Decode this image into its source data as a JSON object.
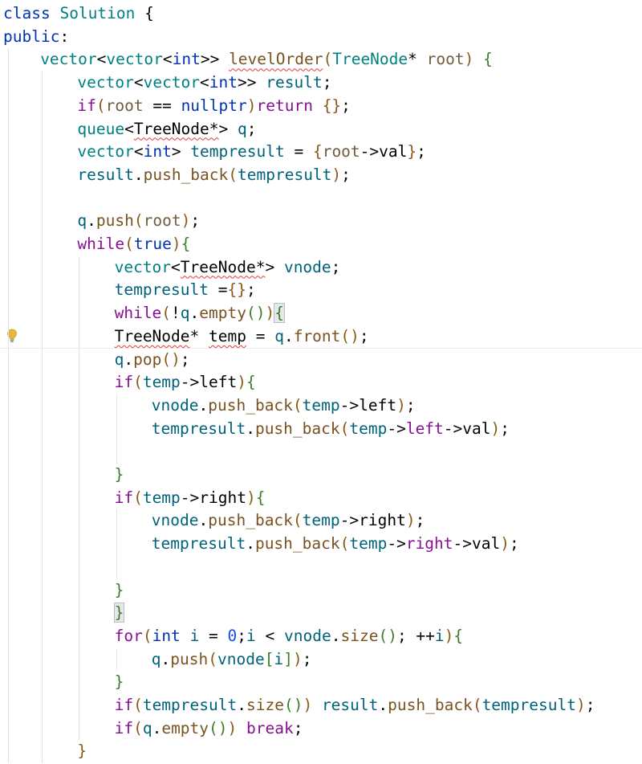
{
  "editor": {
    "lines": [
      {
        "indent": 0,
        "tokens": [
          {
            "t": "class ",
            "c": "t-kw"
          },
          {
            "t": "Solution",
            "c": "t-type"
          },
          {
            "t": " {",
            "c": "t-op"
          }
        ]
      },
      {
        "indent": 0,
        "tokens": [
          {
            "t": "public",
            "c": "t-kw"
          },
          {
            "t": ":",
            "c": "t-op"
          }
        ]
      },
      {
        "indent": 1,
        "tokens": [
          {
            "t": "vector",
            "c": "t-type"
          },
          {
            "t": "<",
            "c": "t-op"
          },
          {
            "t": "vector",
            "c": "t-type"
          },
          {
            "t": "<",
            "c": "t-op"
          },
          {
            "t": "int",
            "c": "t-kw"
          },
          {
            "t": ">> ",
            "c": "t-op"
          },
          {
            "t": "levelOrder",
            "c": "t-method",
            "sq": true
          },
          {
            "t": "(",
            "c": "t-paren1"
          },
          {
            "t": "TreeNode",
            "c": "t-type"
          },
          {
            "t": "* ",
            "c": "t-op"
          },
          {
            "t": "root",
            "c": "t-param"
          },
          {
            "t": ") ",
            "c": "t-paren1"
          },
          {
            "t": "{",
            "c": "t-paren2"
          }
        ]
      },
      {
        "indent": 2,
        "tokens": [
          {
            "t": "vector",
            "c": "t-type"
          },
          {
            "t": "<",
            "c": "t-op"
          },
          {
            "t": "vector",
            "c": "t-type"
          },
          {
            "t": "<",
            "c": "t-op"
          },
          {
            "t": "int",
            "c": "t-kw"
          },
          {
            "t": ">> ",
            "c": "t-op"
          },
          {
            "t": "result",
            "c": "t-fn"
          },
          {
            "t": ";",
            "c": "t-op"
          }
        ]
      },
      {
        "indent": 2,
        "tokens": [
          {
            "t": "if",
            "c": "t-ctl"
          },
          {
            "t": "(",
            "c": "t-paren1"
          },
          {
            "t": "root",
            "c": "t-param"
          },
          {
            "t": " == ",
            "c": "t-op"
          },
          {
            "t": "nullptr",
            "c": "t-kw"
          },
          {
            "t": ")",
            "c": "t-paren1"
          },
          {
            "t": "return ",
            "c": "t-ctl"
          },
          {
            "t": "{}",
            "c": "t-paren1"
          },
          {
            "t": ";",
            "c": "t-op"
          }
        ]
      },
      {
        "indent": 2,
        "tokens": [
          {
            "t": "queue",
            "c": "t-type"
          },
          {
            "t": "<",
            "c": "t-op"
          },
          {
            "t": "TreeNode*",
            "c": "t-cls",
            "sq": true
          },
          {
            "t": "> ",
            "c": "t-op"
          },
          {
            "t": "q",
            "c": "t-fn"
          },
          {
            "t": ";",
            "c": "t-op"
          }
        ]
      },
      {
        "indent": 2,
        "tokens": [
          {
            "t": "vector",
            "c": "t-type"
          },
          {
            "t": "<",
            "c": "t-op"
          },
          {
            "t": "int",
            "c": "t-kw"
          },
          {
            "t": "> ",
            "c": "t-op"
          },
          {
            "t": "tempresult",
            "c": "t-fn"
          },
          {
            "t": " = ",
            "c": "t-op"
          },
          {
            "t": "{",
            "c": "t-paren1"
          },
          {
            "t": "root",
            "c": "t-param"
          },
          {
            "t": "->",
            "c": "t-op"
          },
          {
            "t": "val",
            "c": "t-cls"
          },
          {
            "t": "}",
            "c": "t-paren1"
          },
          {
            "t": ";",
            "c": "t-op"
          }
        ]
      },
      {
        "indent": 2,
        "tokens": [
          {
            "t": "result",
            "c": "t-fn"
          },
          {
            "t": ".",
            "c": "t-op"
          },
          {
            "t": "push_back",
            "c": "t-method"
          },
          {
            "t": "(",
            "c": "t-paren1"
          },
          {
            "t": "tempresult",
            "c": "t-fn"
          },
          {
            "t": ")",
            "c": "t-paren1"
          },
          {
            "t": ";",
            "c": "t-op"
          }
        ]
      },
      {
        "indent": 2,
        "tokens": []
      },
      {
        "indent": 2,
        "tokens": [
          {
            "t": "q",
            "c": "t-fn"
          },
          {
            "t": ".",
            "c": "t-op"
          },
          {
            "t": "push",
            "c": "t-method"
          },
          {
            "t": "(",
            "c": "t-paren1"
          },
          {
            "t": "root",
            "c": "t-param"
          },
          {
            "t": ")",
            "c": "t-paren1"
          },
          {
            "t": ";",
            "c": "t-op"
          }
        ]
      },
      {
        "indent": 2,
        "tokens": [
          {
            "t": "while",
            "c": "t-ctl"
          },
          {
            "t": "(",
            "c": "t-paren1"
          },
          {
            "t": "true",
            "c": "t-kw"
          },
          {
            "t": ")",
            "c": "t-paren1"
          },
          {
            "t": "{",
            "c": "t-paren2"
          }
        ]
      },
      {
        "indent": 3,
        "tokens": [
          {
            "t": "vector",
            "c": "t-type"
          },
          {
            "t": "<",
            "c": "t-op"
          },
          {
            "t": "TreeNode*",
            "c": "t-cls",
            "sq": true
          },
          {
            "t": "> ",
            "c": "t-op"
          },
          {
            "t": "vnode",
            "c": "t-fn"
          },
          {
            "t": ";",
            "c": "t-op"
          }
        ]
      },
      {
        "indent": 3,
        "tokens": [
          {
            "t": "tempresult",
            "c": "t-fn"
          },
          {
            "t": " =",
            "c": "t-op"
          },
          {
            "t": "{}",
            "c": "t-paren1"
          },
          {
            "t": ";",
            "c": "t-op"
          }
        ]
      },
      {
        "indent": 3,
        "tokens": [
          {
            "t": "while",
            "c": "t-ctl"
          },
          {
            "t": "(",
            "c": "t-paren1"
          },
          {
            "t": "!",
            "c": "t-op"
          },
          {
            "t": "q",
            "c": "t-fn"
          },
          {
            "t": ".",
            "c": "t-op"
          },
          {
            "t": "empty",
            "c": "t-method"
          },
          {
            "t": "()",
            "c": "t-paren2"
          },
          {
            "t": ")",
            "c": "t-paren1"
          },
          {
            "t": "{",
            "c": "t-paren2",
            "m": true
          }
        ]
      },
      {
        "indent": 3,
        "tokens": [
          {
            "t": "TreeNode",
            "c": "t-cls",
            "sq": true
          },
          {
            "t": "* ",
            "c": "t-op"
          },
          {
            "t": "temp",
            "c": "t-cls",
            "sq": true
          },
          {
            "t": " = ",
            "c": "t-op"
          },
          {
            "t": "q",
            "c": "t-fn"
          },
          {
            "t": ".",
            "c": "t-op"
          },
          {
            "t": "front",
            "c": "t-method"
          },
          {
            "t": "()",
            "c": "t-paren1"
          },
          {
            "t": ";",
            "c": "t-op"
          }
        ]
      },
      {
        "indent": 3,
        "tokens": [
          {
            "t": "q",
            "c": "t-fn"
          },
          {
            "t": ".",
            "c": "t-op"
          },
          {
            "t": "pop",
            "c": "t-method"
          },
          {
            "t": "()",
            "c": "t-paren1"
          },
          {
            "t": ";",
            "c": "t-op"
          }
        ]
      },
      {
        "indent": 3,
        "tokens": [
          {
            "t": "if",
            "c": "t-ctl"
          },
          {
            "t": "(",
            "c": "t-paren1"
          },
          {
            "t": "temp",
            "c": "t-fn"
          },
          {
            "t": "->",
            "c": "t-op"
          },
          {
            "t": "left",
            "c": "t-cls"
          },
          {
            "t": ")",
            "c": "t-paren1"
          },
          {
            "t": "{",
            "c": "t-paren2"
          }
        ]
      },
      {
        "indent": 4,
        "tokens": [
          {
            "t": "vnode",
            "c": "t-fn"
          },
          {
            "t": ".",
            "c": "t-op"
          },
          {
            "t": "push_back",
            "c": "t-method"
          },
          {
            "t": "(",
            "c": "t-paren1"
          },
          {
            "t": "temp",
            "c": "t-fn"
          },
          {
            "t": "->",
            "c": "t-op"
          },
          {
            "t": "left",
            "c": "t-cls"
          },
          {
            "t": ")",
            "c": "t-paren1"
          },
          {
            "t": ";",
            "c": "t-op"
          }
        ]
      },
      {
        "indent": 4,
        "tokens": [
          {
            "t": "tempresult",
            "c": "t-fn"
          },
          {
            "t": ".",
            "c": "t-op"
          },
          {
            "t": "push_back",
            "c": "t-method"
          },
          {
            "t": "(",
            "c": "t-paren1"
          },
          {
            "t": "temp",
            "c": "t-fn"
          },
          {
            "t": "->",
            "c": "t-op"
          },
          {
            "t": "left",
            "c": "t-field"
          },
          {
            "t": "->",
            "c": "t-op"
          },
          {
            "t": "val",
            "c": "t-cls"
          },
          {
            "t": ")",
            "c": "t-paren1"
          },
          {
            "t": ";",
            "c": "t-op"
          }
        ]
      },
      {
        "indent": 4,
        "tokens": []
      },
      {
        "indent": 3,
        "tokens": [
          {
            "t": "}",
            "c": "t-paren2"
          }
        ]
      },
      {
        "indent": 3,
        "tokens": [
          {
            "t": "if",
            "c": "t-ctl"
          },
          {
            "t": "(",
            "c": "t-paren1"
          },
          {
            "t": "temp",
            "c": "t-fn"
          },
          {
            "t": "->",
            "c": "t-op"
          },
          {
            "t": "right",
            "c": "t-cls"
          },
          {
            "t": ")",
            "c": "t-paren1"
          },
          {
            "t": "{",
            "c": "t-paren2"
          }
        ]
      },
      {
        "indent": 4,
        "tokens": [
          {
            "t": "vnode",
            "c": "t-fn"
          },
          {
            "t": ".",
            "c": "t-op"
          },
          {
            "t": "push_back",
            "c": "t-method"
          },
          {
            "t": "(",
            "c": "t-paren1"
          },
          {
            "t": "temp",
            "c": "t-fn"
          },
          {
            "t": "->",
            "c": "t-op"
          },
          {
            "t": "right",
            "c": "t-cls"
          },
          {
            "t": ")",
            "c": "t-paren1"
          },
          {
            "t": ";",
            "c": "t-op"
          }
        ]
      },
      {
        "indent": 4,
        "tokens": [
          {
            "t": "tempresult",
            "c": "t-fn"
          },
          {
            "t": ".",
            "c": "t-op"
          },
          {
            "t": "push_back",
            "c": "t-method"
          },
          {
            "t": "(",
            "c": "t-paren1"
          },
          {
            "t": "temp",
            "c": "t-fn"
          },
          {
            "t": "->",
            "c": "t-op"
          },
          {
            "t": "right",
            "c": "t-field"
          },
          {
            "t": "->",
            "c": "t-op"
          },
          {
            "t": "val",
            "c": "t-cls"
          },
          {
            "t": ")",
            "c": "t-paren1"
          },
          {
            "t": ";",
            "c": "t-op"
          }
        ]
      },
      {
        "indent": 4,
        "tokens": []
      },
      {
        "indent": 3,
        "tokens": [
          {
            "t": "}",
            "c": "t-paren2"
          }
        ]
      },
      {
        "indent": 3,
        "tokens": [
          {
            "t": "}",
            "c": "t-paren2",
            "m": true
          }
        ]
      },
      {
        "indent": 3,
        "tokens": [
          {
            "t": "for",
            "c": "t-ctl"
          },
          {
            "t": "(",
            "c": "t-paren1"
          },
          {
            "t": "int",
            "c": "t-kw"
          },
          {
            "t": " ",
            "c": "t-op"
          },
          {
            "t": "i",
            "c": "t-fn"
          },
          {
            "t": " = ",
            "c": "t-op"
          },
          {
            "t": "0",
            "c": "t-num"
          },
          {
            "t": ";",
            "c": "t-op"
          },
          {
            "t": "i",
            "c": "t-fn"
          },
          {
            "t": " < ",
            "c": "t-op"
          },
          {
            "t": "vnode",
            "c": "t-fn"
          },
          {
            "t": ".",
            "c": "t-op"
          },
          {
            "t": "size",
            "c": "t-method"
          },
          {
            "t": "()",
            "c": "t-paren2"
          },
          {
            "t": "; ",
            "c": "t-op"
          },
          {
            "t": "++",
            "c": "t-op"
          },
          {
            "t": "i",
            "c": "t-fn"
          },
          {
            "t": ")",
            "c": "t-paren1"
          },
          {
            "t": "{",
            "c": "t-paren2"
          }
        ]
      },
      {
        "indent": 4,
        "tokens": [
          {
            "t": "q",
            "c": "t-fn"
          },
          {
            "t": ".",
            "c": "t-op"
          },
          {
            "t": "push",
            "c": "t-method"
          },
          {
            "t": "(",
            "c": "t-paren1"
          },
          {
            "t": "vnode",
            "c": "t-fn"
          },
          {
            "t": "[",
            "c": "t-paren2"
          },
          {
            "t": "i",
            "c": "t-fn"
          },
          {
            "t": "]",
            "c": "t-paren2"
          },
          {
            "t": ")",
            "c": "t-paren1"
          },
          {
            "t": ";",
            "c": "t-op"
          }
        ]
      },
      {
        "indent": 3,
        "tokens": [
          {
            "t": "}",
            "c": "t-paren2"
          }
        ]
      },
      {
        "indent": 3,
        "tokens": [
          {
            "t": "if",
            "c": "t-ctl"
          },
          {
            "t": "(",
            "c": "t-paren1"
          },
          {
            "t": "tempresult",
            "c": "t-fn"
          },
          {
            "t": ".",
            "c": "t-op"
          },
          {
            "t": "size",
            "c": "t-method"
          },
          {
            "t": "()",
            "c": "t-paren2"
          },
          {
            "t": ")",
            "c": "t-paren1"
          },
          {
            "t": " ",
            "c": "t-op"
          },
          {
            "t": "result",
            "c": "t-fn"
          },
          {
            "t": ".",
            "c": "t-op"
          },
          {
            "t": "push_back",
            "c": "t-method"
          },
          {
            "t": "(",
            "c": "t-paren1"
          },
          {
            "t": "tempresult",
            "c": "t-fn"
          },
          {
            "t": ")",
            "c": "t-paren1"
          },
          {
            "t": ";",
            "c": "t-op"
          }
        ]
      },
      {
        "indent": 3,
        "tokens": [
          {
            "t": "if",
            "c": "t-ctl"
          },
          {
            "t": "(",
            "c": "t-paren1"
          },
          {
            "t": "q",
            "c": "t-fn"
          },
          {
            "t": ".",
            "c": "t-op"
          },
          {
            "t": "empty",
            "c": "t-method"
          },
          {
            "t": "()",
            "c": "t-paren2"
          },
          {
            "t": ")",
            "c": "t-paren1"
          },
          {
            "t": " ",
            "c": "t-op"
          },
          {
            "t": "break",
            "c": "t-ctl"
          },
          {
            "t": ";",
            "c": "t-op"
          }
        ]
      },
      {
        "indent": 2,
        "tokens": [
          {
            "t": "}",
            "c": "t-paren1"
          }
        ]
      }
    ],
    "caret_line": 14,
    "intention_bulb_icon": "lightbulb-icon",
    "colors": {
      "background": "#ffffff",
      "indent_guide": "#e3e3e3",
      "error_squiggle": "#e53935",
      "bulb": "#e2b93b"
    }
  }
}
